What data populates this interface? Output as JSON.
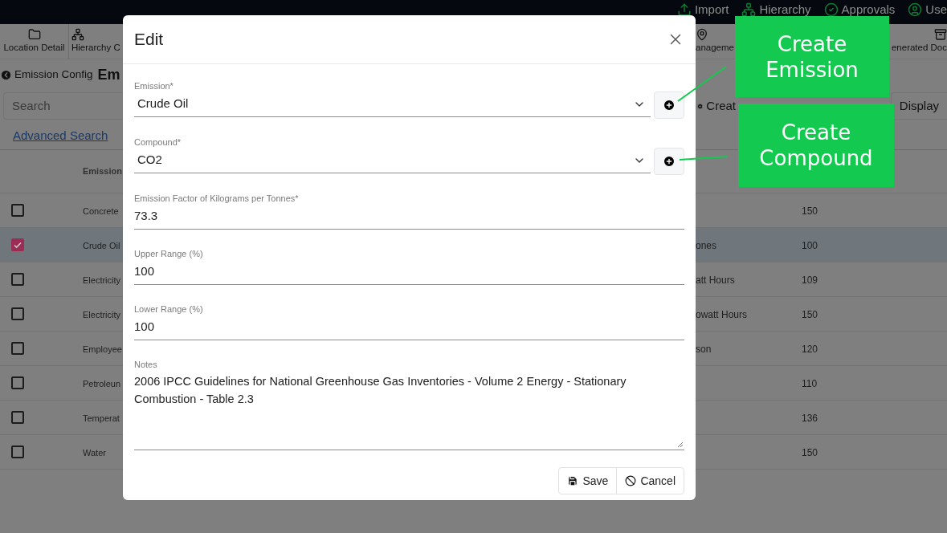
{
  "top_bar": {
    "items": [
      {
        "kind": "upload",
        "label": "Import"
      },
      {
        "kind": "hierarchy",
        "label": "Hierarchy"
      },
      {
        "kind": "check",
        "label": "Approvals"
      },
      {
        "kind": "user",
        "label": "Use"
      }
    ]
  },
  "toolbar": {
    "items": [
      {
        "kind": "folder",
        "label": "Location Detail"
      },
      {
        "kind": "hierarchy",
        "label": "Hierarchy C"
      },
      {
        "kind": "pin",
        "label": "anageme"
      },
      {
        "kind": "archive",
        "label": "enerated Doc"
      }
    ]
  },
  "breadcrumb": {
    "back": "Emission Config",
    "title": "Em"
  },
  "search": {
    "placeholder": "Search"
  },
  "actions": [
    {
      "kind": "create",
      "label": "Creat"
    },
    {
      "kind": "display",
      "label": "Display"
    }
  ],
  "advanced_search": "Advanced Search",
  "table": {
    "columns": [
      "Emission"
    ],
    "rows": [
      {
        "selected": false,
        "emission": "Concrete",
        "value": "150"
      },
      {
        "selected": true,
        "emission": "Crude Oil",
        "column_3": "ones",
        "value": "100"
      },
      {
        "selected": false,
        "emission": "Electricity",
        "column_3": "att Hours",
        "value": "109"
      },
      {
        "selected": false,
        "emission": "Electricity",
        "column_3": "owatt Hours",
        "value": "150"
      },
      {
        "selected": false,
        "emission": "Employee",
        "column_3": "son",
        "value": "120"
      },
      {
        "selected": false,
        "emission": "Petroleun",
        "value": "110"
      },
      {
        "selected": false,
        "emission": "Temperat",
        "value": "136"
      },
      {
        "selected": false,
        "emission": "Water",
        "value": "150"
      }
    ]
  },
  "dialog": {
    "title": "Edit",
    "fields": [
      {
        "kind": "select",
        "label": "Emission*",
        "value": "Crude Oil"
      },
      {
        "kind": "select",
        "label": "Compound*",
        "value": "CO2"
      },
      {
        "kind": "text",
        "label": "Emission Factor of Kilograms per Tonnes*",
        "value": "73.3"
      },
      {
        "kind": "text",
        "label": "Upper Range (%)",
        "value": "100"
      },
      {
        "kind": "text",
        "label": "Lower Range (%)",
        "value": "100"
      },
      {
        "kind": "textarea",
        "label": "Notes",
        "value": "2006 IPCC Guidelines for National Greenhouse Gas Inventories - Volume 2 Energy - Stationary Combustion - Table 2.3"
      }
    ],
    "buttons": [
      {
        "kind": "save",
        "label": "Save"
      },
      {
        "kind": "cancel",
        "label": "Cancel"
      }
    ]
  },
  "callouts": [
    {
      "label": "Create Emission"
    },
    {
      "label": "Create Compound"
    }
  ]
}
